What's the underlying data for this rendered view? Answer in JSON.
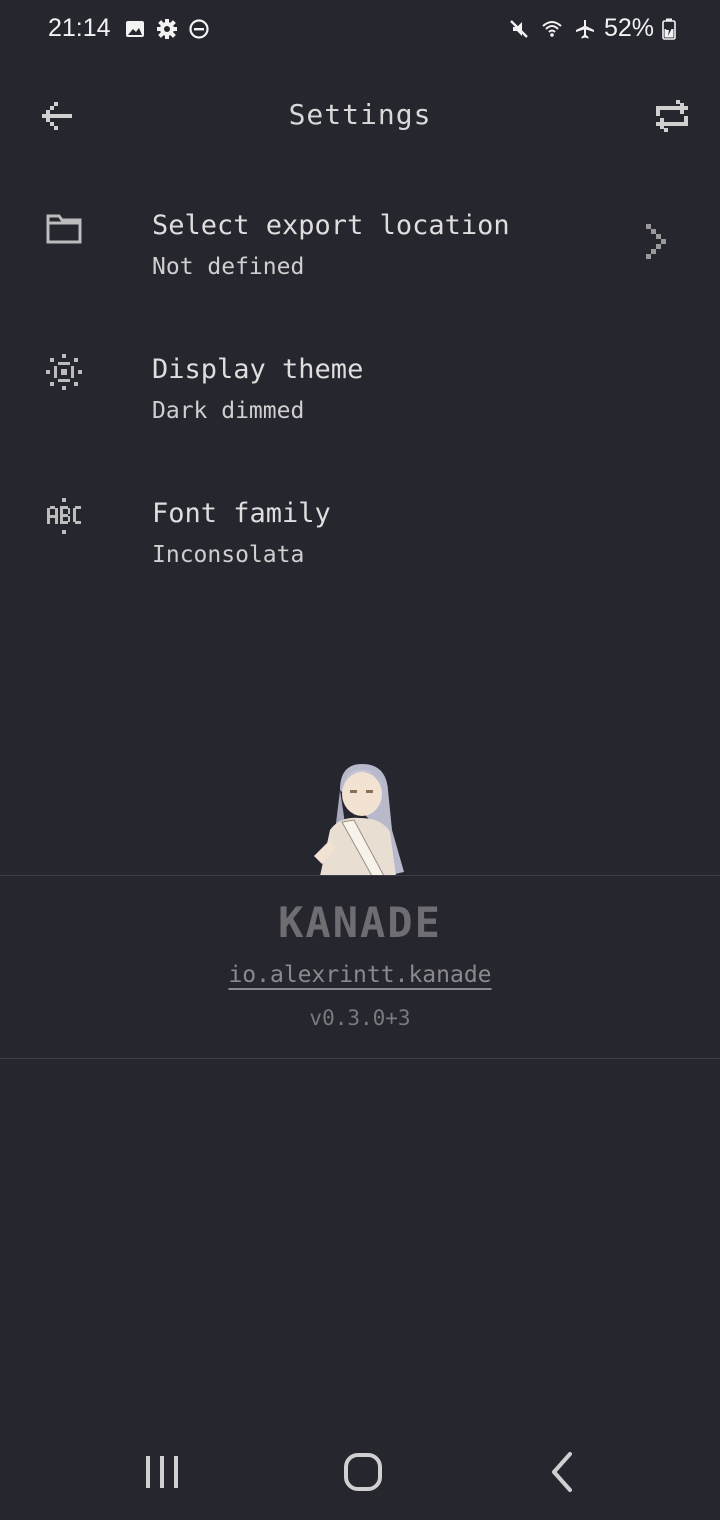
{
  "status_bar": {
    "time": "21:14",
    "battery": "52%",
    "left_icons": [
      "image-icon",
      "gear-icon",
      "do-not-disturb-icon"
    ],
    "right_icons": [
      "mute-icon",
      "wifi-icon",
      "airplane-icon",
      "battery-icon"
    ]
  },
  "app_bar": {
    "title": "Settings",
    "back_icon": "arrow-left-icon",
    "action_icon": "swap-icon"
  },
  "settings": {
    "items": [
      {
        "icon": "folder-icon",
        "title": "Select export location",
        "subtitle": "Not defined",
        "has_chevron": true
      },
      {
        "icon": "theme-icon",
        "title": "Display theme",
        "subtitle": "Dark dimmed"
      },
      {
        "icon": "abc-icon",
        "title": "Font family",
        "subtitle": "Inconsolata"
      }
    ]
  },
  "about": {
    "app_name": "KANADE",
    "package": "io.alexrintt.kanade",
    "version": "v0.3.0+3"
  },
  "colors": {
    "background": "#25262e",
    "text": "#d8d8d8",
    "muted": "#8a8a8e",
    "divider": "#3d3e47"
  }
}
